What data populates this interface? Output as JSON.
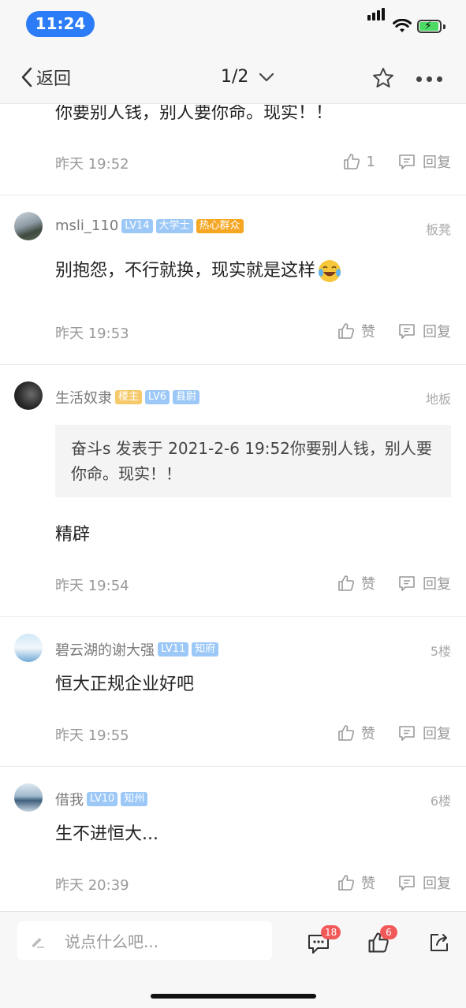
{
  "status": {
    "time": "11:24"
  },
  "nav": {
    "back_label": "返回",
    "page_indicator": "1/2"
  },
  "posts": [
    {
      "text": "你要别人钱，别人要你命。现实！！",
      "time": "昨天 19:52",
      "like_label": "1",
      "reply_label": "回复"
    },
    {
      "username": "msli_110",
      "badges": [
        "LV14",
        "大学士",
        "热心群众"
      ],
      "floor": "板凳",
      "text": "别抱怨，不行就换，现实就是这样",
      "time": "昨天 19:53",
      "like_label": "赞",
      "reply_label": "回复"
    },
    {
      "username": "生活奴隶",
      "badges": [
        "楼主",
        "LV6",
        "县尉"
      ],
      "floor": "地板",
      "quote": "奋斗s 发表于 2021-2-6 19:52你要别人钱，别人要你命。现实！！",
      "text": "精辟",
      "time": "昨天 19:54",
      "like_label": "赞",
      "reply_label": "回复"
    },
    {
      "username": "碧云湖的谢大强",
      "badges": [
        "LV11",
        "知府"
      ],
      "floor": "5楼",
      "text": "恒大正规企业好吧",
      "time": "昨天 19:55",
      "like_label": "赞",
      "reply_label": "回复"
    },
    {
      "username": "借我",
      "badges": [
        "LV10",
        "知州"
      ],
      "floor": "6楼",
      "text": "生不进恒大...",
      "time": "昨天 20:39",
      "like_label": "赞",
      "reply_label": "回复"
    }
  ],
  "bottom": {
    "input_placeholder": "说点什么吧...",
    "comment_count": "18",
    "like_count": "6"
  },
  "colors": {
    "accent": "#2b7cf6",
    "badge_blue": "#9cc8f7",
    "badge_orange": "#f5a623",
    "badge_yellow": "#f6c96b",
    "count_red": "#f25a5a"
  }
}
